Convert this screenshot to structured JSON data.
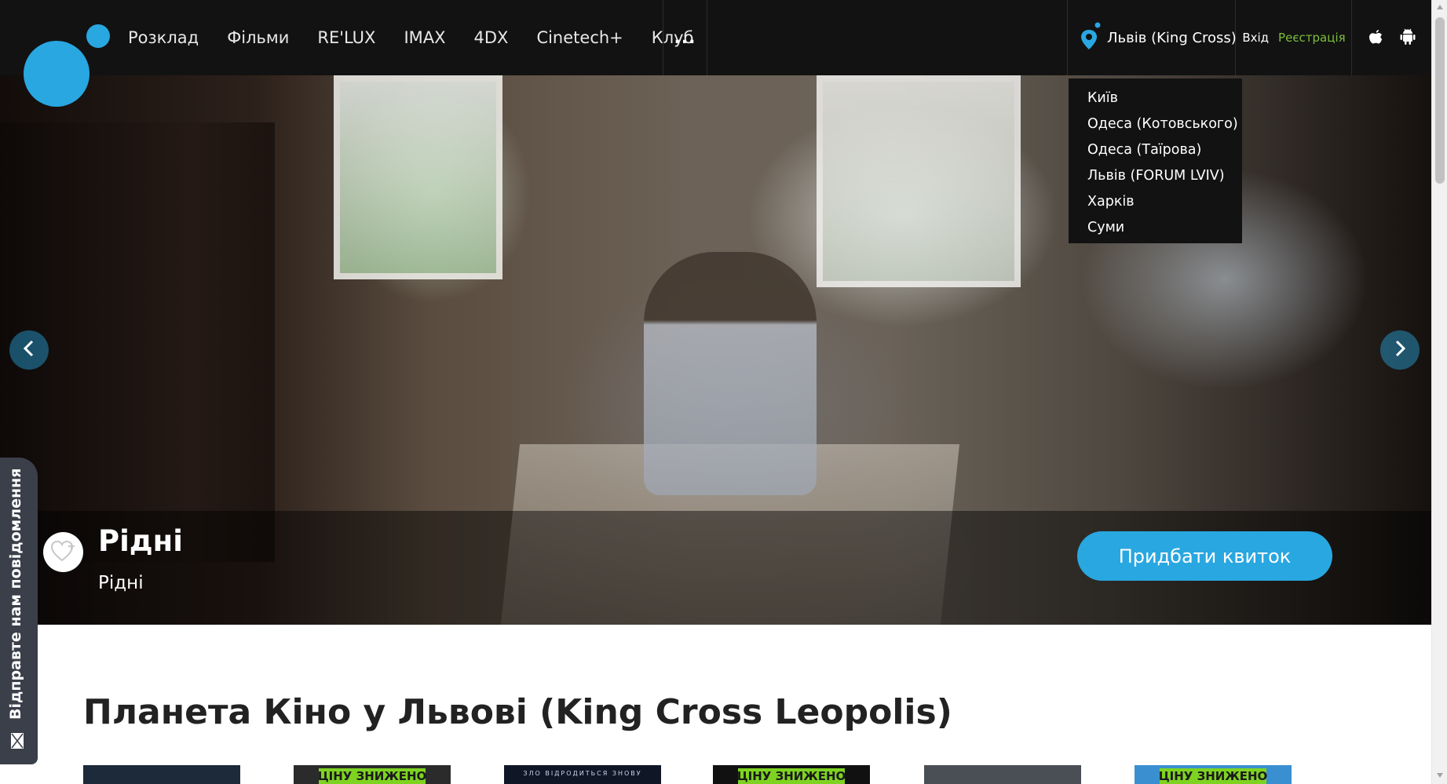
{
  "nav": {
    "items": [
      "Розклад",
      "Фільми",
      "RE'LUX",
      "IMAX",
      "4DX",
      "Cinetech+",
      "Клуб"
    ],
    "more_label": "...",
    "more_icon": "ellipsis-icon"
  },
  "city": {
    "current": "Львів (King Cross)",
    "icon": "location-pin-icon",
    "options": [
      "Київ",
      "Одеса (Котовського)",
      "Одеса (Таїрова)",
      "Львів (FORUM LVIV)",
      "Харків",
      "Суми"
    ]
  },
  "auth": {
    "login": "Вхід",
    "register": "Реєстрація"
  },
  "apps": {
    "ios_icon": "apple-icon",
    "android_icon": "android-icon"
  },
  "hero": {
    "title": "Рідні",
    "subtitle": "Рідні",
    "buy_label": "Придбати квиток",
    "favorite_icon": "heart-plus-icon",
    "prev_icon": "chevron-left-icon",
    "next_icon": "chevron-right-icon"
  },
  "feedback": {
    "label": "Відправте нам повідомлення",
    "icon": "envelope-icon"
  },
  "section": {
    "title": "Планета Кіно у Львові (King Cross Leopolis)"
  },
  "posters": [
    {
      "badge": "",
      "tagline": "",
      "color": "#1d2a3a"
    },
    {
      "badge": "ЦІНУ ЗНИЖЕНО",
      "tagline": "",
      "color": "#2b2b2b"
    },
    {
      "badge": "",
      "tagline": "ЗЛО ВІДРОДИТЬСЯ ЗНОВУ",
      "color": "#0f1626"
    },
    {
      "badge": "ЦІНУ ЗНИЖЕНО",
      "tagline": "",
      "color": "#111111"
    },
    {
      "badge": "",
      "tagline": "",
      "color": "#4a4f55"
    },
    {
      "badge": "ЦІНУ ЗНИЖЕНО",
      "tagline": "",
      "color": "#3a8fd0"
    }
  ],
  "colors": {
    "brand_blue": "#29a7e1",
    "nav_bg": "#121212",
    "register_green": "#7bbf3a",
    "badge_green": "#7ed321"
  }
}
